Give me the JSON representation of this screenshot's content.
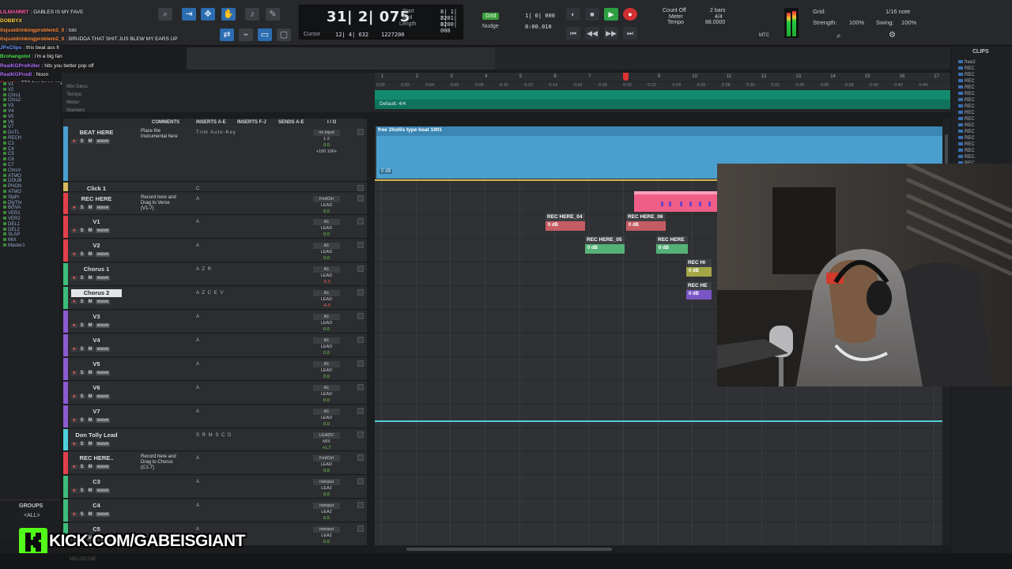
{
  "chat": [
    {
      "user": "LILMAMMIT",
      "color": "#ff5aa5",
      "text": ": GABLES IS MY FAVE"
    },
    {
      "user": "DOBBYX",
      "color": "#ffd23c",
      "text": ""
    },
    {
      "user": "itsjustdrinkingproblem2_0",
      "color": "#ff8c3c",
      "text": ": tcki"
    },
    {
      "user": "itsjustdrinkingproblem2_0",
      "color": "#ff8c3c",
      "text": ": BRUDDA THAT SHIT JUS BLEW MY EARS UP"
    },
    {
      "user": "JPxClips",
      "color": "#6a9bff",
      "text": ": this beat ass fr"
    },
    {
      "user": "Brohangolol",
      "color": "#50e050",
      "text": ": i'm a big fan"
    },
    {
      "user": "RealKGProKiller",
      "color": "#b070ff",
      "text": ": hits you better pop off"
    },
    {
      "user": "RealKGProdl",
      "color": "#b070ff",
      "text": ": Noon"
    },
    {
      "user": "lilrasta",
      "color": "#ff4040",
      "text": ": TTS has been enabled."
    }
  ],
  "counter": {
    "main": "31| 2| 075",
    "start_label": "Start",
    "start": "8| 1| 320",
    "end_label": "End",
    "end": "8| 1| 320",
    "length_label": "Length",
    "length": "0| 0| 000",
    "cursor_label": "Cursor",
    "cursor": "12| 4| 632",
    "samples": "1227200"
  },
  "grid_nudge": {
    "grid": "Grid",
    "grid_val": "1| 0| 000",
    "nudge": "Nudge",
    "nudge_val": "0:00.010"
  },
  "countoff": {
    "count_off": "Count Off",
    "meter": "Meter",
    "tempo": "Tempo",
    "bars": "2 bars",
    "meter_val": "4/4",
    "tempo_val": "88.0000",
    "mtc": "MTC"
  },
  "right_grid": {
    "grid": "Grid:",
    "grid_val": "1/16 note",
    "strength": "Strength:",
    "strength_val": "100%",
    "swing": "Swing:",
    "swing_val": "100%"
  },
  "ruler": {
    "rows": [
      "Min:Secs",
      "Tempo",
      "Meter",
      "Markers"
    ],
    "bars": [
      "1",
      "2",
      "3",
      "4",
      "5",
      "6",
      "7",
      "8",
      "9",
      "10",
      "11",
      "12",
      "13",
      "14",
      "15",
      "16",
      "17"
    ],
    "secs": [
      "0:00",
      "0:02",
      "0:04",
      "0:05",
      "0:08",
      "0:10",
      "0:12",
      "0:14",
      "0:16",
      "0:18",
      "0:20",
      "0:22",
      "0:24",
      "0:26",
      "0:28",
      "0:30",
      "0:32",
      "0:34",
      "0:36",
      "0:38",
      "0:40",
      "0:42",
      "0:44"
    ],
    "meter_label": "Default: 4/4"
  },
  "col_headers": {
    "comments": "COMMENTS",
    "inserts_ae": "INSERTS A-E",
    "inserts_fj": "INSERTS F-J",
    "sends_ae": "SENDS A-E",
    "io": "I / O"
  },
  "tracks": [
    {
      "name": "BEAT HERE",
      "color": "#4b9fcf",
      "comment": "Place the\nInstrumental here",
      "inserts": "Trim  Auto-Key",
      "io1": "no input",
      "io2": "1-2",
      "vol": "0.0",
      "pan": "+100  100+",
      "height": 70
    },
    {
      "name": "Click 1",
      "color": "#d7b85a",
      "comment": "",
      "inserts": "C",
      "io1": "",
      "io2": "",
      "vol": "",
      "pan": "",
      "height": 12
    },
    {
      "name": "REC HERE",
      "color": "#e0404b",
      "comment": "Record here and\nDrag to Verse\n(V1-7)",
      "inserts": "A",
      "io1": "FmtCtrl",
      "io2": "LEAD",
      "vol": "0.0",
      "pan": "",
      "height": 28
    },
    {
      "name": "V1",
      "color": "#e0404b",
      "comment": "",
      "inserts": "A",
      "io1": "A1",
      "io2": "LEAD",
      "vol": "0.0",
      "pan": "",
      "height": 29
    },
    {
      "name": "V2",
      "color": "#e0404b",
      "comment": "",
      "inserts": "A",
      "io1": "A1",
      "io2": "LEAD",
      "vol": "0.0",
      "pan": "",
      "height": 29
    },
    {
      "name": "Chorus 1",
      "color": "#3bbd7a",
      "comment": "",
      "inserts": "A Z R",
      "io1": "A1",
      "io2": "LEAD",
      "vol": "-5.3",
      "pan": "",
      "height": 29
    },
    {
      "name": "Chorus 2",
      "color": "#3bbd7a",
      "comment": "",
      "inserts": "A Z C E V",
      "io1": "A1",
      "io2": "LEAD",
      "vol": "-6.0",
      "pan": "",
      "height": 29,
      "selected": true
    },
    {
      "name": "V3",
      "color": "#8a5ad0",
      "comment": "",
      "inserts": "A",
      "io1": "A1",
      "io2": "LEAD",
      "vol": "0.0",
      "pan": "",
      "height": 29
    },
    {
      "name": "V4",
      "color": "#8a5ad0",
      "comment": "",
      "inserts": "A",
      "io1": "A1",
      "io2": "LEAD",
      "vol": "0.0",
      "pan": "",
      "height": 29
    },
    {
      "name": "V5",
      "color": "#8a5ad0",
      "comment": "",
      "inserts": "A",
      "io1": "A1",
      "io2": "LEAD",
      "vol": "0.0",
      "pan": "",
      "height": 29
    },
    {
      "name": "V6",
      "color": "#8a5ad0",
      "comment": "",
      "inserts": "A",
      "io1": "A1",
      "io2": "LEAD",
      "vol": "0.0",
      "pan": "",
      "height": 29
    },
    {
      "name": "V7",
      "color": "#8a5ad0",
      "comment": "",
      "inserts": "A",
      "io1": "A1",
      "io2": "LEAD",
      "vol": "0.0",
      "pan": "",
      "height": 29
    },
    {
      "name": "Don Tolly Lead",
      "color": "#4ed0d8",
      "comment": "",
      "inserts": "S R M S C D",
      "io1": "LEADV",
      "io2": "MIX",
      "vol": "+1.7",
      "pan": "",
      "height": 28
    },
    {
      "name": "REC HERE..",
      "color": "#e0404b",
      "comment": "Record here and\nDrag to Chorus\n(C1-7)",
      "inserts": "A",
      "io1": "FmtCtrl",
      "io2": "LEAD",
      "vol": "0.0",
      "pan": "",
      "height": 29
    },
    {
      "name": "C3",
      "color": "#3bbd7a",
      "comment": "",
      "inserts": "A",
      "io1": "noinput",
      "io2": "LEA2",
      "vol": "0.0",
      "pan": "",
      "height": 29
    },
    {
      "name": "C4",
      "color": "#3bbd7a",
      "comment": "",
      "inserts": "A",
      "io1": "noinput",
      "io2": "LEA2",
      "vol": "0.0",
      "pan": "",
      "height": 29
    },
    {
      "name": "C5",
      "color": "#3bbd7a",
      "comment": "",
      "inserts": "A",
      "io1": "noinput",
      "io2": "LEA2",
      "vol": "0.0",
      "pan": "",
      "height": 29
    }
  ],
  "beat_clip": {
    "title": "free 2hollis type beat 1901",
    "gain": "0 dB"
  },
  "clips": [
    {
      "name": "REC HERE_04",
      "gain": "0 dB",
      "color": "#c65c63"
    },
    {
      "name": "REC HERE_06",
      "gain": "0 dB",
      "color": "#c65c63"
    },
    {
      "name": "REC HERE_05",
      "gain": "0 dB",
      "color": "#56b178"
    },
    {
      "name": "REC HERE",
      "gain": "0 dB",
      "color": "#56b178"
    },
    {
      "name": "REC HI",
      "gain": "0 dB",
      "color": "#a3a647"
    },
    {
      "name": "REC HE",
      "gain": "0 dB",
      "color": "#7a55c6"
    }
  ],
  "left_list": [
    "V1",
    "V2",
    "Chrs1",
    "Chrs2",
    "V3",
    "V4",
    "V5",
    "V6",
    "V7",
    "DnTL",
    "RECH",
    "C3",
    "C4",
    "C5",
    "C6",
    "C7",
    "ChrsV",
    "ATMO",
    "DOUB",
    "PHON",
    "ATMO",
    "SlpPr",
    "DlyThr",
    "BGVA",
    "VER1",
    "VER2",
    "DEL1",
    "DEL2",
    "SLAP",
    "MIX",
    "Master1"
  ],
  "groups": {
    "title": "GROUPS",
    "all": "<ALL>"
  },
  "clips_panel": {
    "title": "CLIPS",
    "items": [
      "free2",
      "REC",
      "REC",
      "REC",
      "REC",
      "REC",
      "REC",
      "REC",
      "REC",
      "REC",
      "REC",
      "REC",
      "REC",
      "REC",
      "REC",
      "REC",
      "REC",
      "REC",
      "REC"
    ]
  },
  "kick": {
    "url": "KICK.COM/GABEISGIANT"
  },
  "bottom": {
    "label": "MELODYNE"
  }
}
